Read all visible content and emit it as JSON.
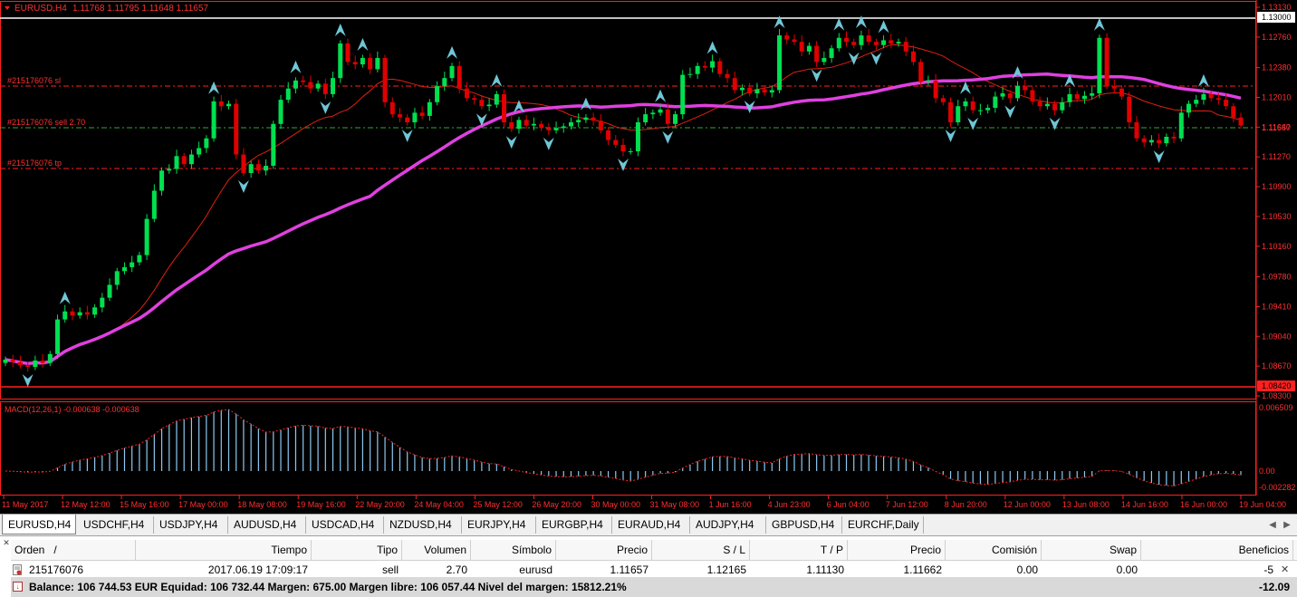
{
  "chart": {
    "symbol_title": "EURUSD,H4",
    "ohlc": "1.11768 1.11795 1.11648 1.11657",
    "price_scale": [
      "1.13130",
      "1.12760",
      "1.12380",
      "1.12010",
      "1.11640",
      "1.11270",
      "1.10900",
      "1.10530",
      "1.10160",
      "1.09780",
      "1.09410",
      "1.09040",
      "1.08670",
      "1.08300"
    ],
    "price_labels": {
      "upper_line": "1.13000",
      "lower_line": "1.08420",
      "current": "1.11657"
    },
    "order_lines": {
      "sl": "#215176076 sl",
      "sell": "#215176076 sell 2.70",
      "tp": "#215176076 tp"
    },
    "macd_label": "MACD(12,26,1) -0.000638 -0.000638",
    "macd_scale": [
      "0.006509",
      "0.00",
      "-0.002282"
    ],
    "time_axis": [
      "11 May 2017",
      "12 May 12:00",
      "15 May 16:00",
      "17 May 00:00",
      "18 May 08:00",
      "19 May 16:00",
      "22 May 20:00",
      "24 May 04:00",
      "25 May 12:00",
      "26 May 20:00",
      "30 May 00:00",
      "31 May 08:00",
      "1 Jun 16:00",
      "4 Jun 23:00",
      "6 Jun 04:00",
      "7 Jun 12:00",
      "8 Jun 20:00",
      "12 Jun 00:00",
      "13 Jun 08:00",
      "14 Jun 16:00",
      "16 Jun 00:00",
      "19 Jun 04:00"
    ],
    "colors": {
      "bull": "#00e050",
      "bear": "#e00000",
      "ma_slow": "#e040e0",
      "ma_fast": "#e02010",
      "arrow": "#6fc6d6",
      "macd": "#8fc8f0"
    }
  },
  "chart_data": {
    "type": "candlestick",
    "symbol": "EURUSD",
    "timeframe": "H4",
    "ylim": [
      1.083,
      1.1313
    ],
    "closes": [
      1.0875,
      1.0872,
      1.0868,
      1.0866,
      1.0874,
      1.0871,
      1.0882,
      1.0925,
      1.0935,
      1.093,
      1.0934,
      1.0931,
      1.094,
      1.0952,
      1.0968,
      1.0985,
      1.099,
      1.0996,
      1.1005,
      1.105,
      1.1085,
      1.111,
      1.1112,
      1.1128,
      1.1118,
      1.113,
      1.1138,
      1.115,
      1.1196,
      1.119,
      1.1193,
      1.113,
      1.1107,
      1.1118,
      1.111,
      1.1116,
      1.1168,
      1.1198,
      1.1212,
      1.1222,
      1.122,
      1.1212,
      1.1218,
      1.1205,
      1.1225,
      1.1268,
      1.1245,
      1.1242,
      1.125,
      1.1236,
      1.125,
      1.1195,
      1.118,
      1.1176,
      1.117,
      1.1182,
      1.1178,
      1.1195,
      1.1215,
      1.1225,
      1.124,
      1.1212,
      1.12,
      1.1198,
      1.119,
      1.1192,
      1.1205,
      1.117,
      1.1162,
      1.1173,
      1.1166,
      1.1168,
      1.1163,
      1.116,
      1.1163,
      1.1165,
      1.117,
      1.1173,
      1.1176,
      1.1172,
      1.116,
      1.1148,
      1.1142,
      1.1134,
      1.1134,
      1.117,
      1.118,
      1.1182,
      1.1186,
      1.1168,
      1.118,
      1.1229,
      1.123,
      1.124,
      1.1238,
      1.1246,
      1.123,
      1.1225,
      1.121,
      1.1213,
      1.1206,
      1.1211,
      1.1207,
      1.121,
      1.1278,
      1.1273,
      1.127,
      1.1258,
      1.1265,
      1.1245,
      1.125,
      1.1262,
      1.1275,
      1.127,
      1.1266,
      1.1278,
      1.127,
      1.1266,
      1.1272,
      1.1268,
      1.127,
      1.1258,
      1.1245,
      1.122,
      1.1222,
      1.12,
      1.1195,
      1.117,
      1.119,
      1.1196,
      1.1185,
      1.1185,
      1.1188,
      1.1202,
      1.1206,
      1.12,
      1.1215,
      1.121,
      1.1196,
      1.119,
      1.1193,
      1.1185,
      1.1195,
      1.1205,
      1.1199,
      1.1203,
      1.1206,
      1.1275,
      1.1215,
      1.1212,
      1.1202,
      1.117,
      1.115,
      1.1145,
      1.1148,
      1.1144,
      1.1152,
      1.115,
      1.1182,
      1.1193,
      1.1198,
      1.1205,
      1.12,
      1.1198,
      1.119,
      1.1176,
      1.1166
    ]
  },
  "tabs": [
    "EURUSD,H4",
    "USDCHF,H4",
    "USDJPY,H4",
    "AUDUSD,H4",
    "USDCAD,H4",
    "NZDUSD,H4",
    "EURJPY,H4",
    "EURGBP,H4",
    "EURAUD,H4",
    "AUDJPY,H4",
    "GBPUSD,H4",
    "EURCHF,Daily"
  ],
  "terminal": {
    "columns": {
      "orden": "Orden",
      "sort": "/",
      "tiempo": "Tiempo",
      "tipo": "Tipo",
      "volumen": "Volumen",
      "simbolo": "Símbolo",
      "precio": "Precio",
      "sl": "S / L",
      "tp": "T / P",
      "precio2": "Precio",
      "comision": "Comisión",
      "swap": "Swap",
      "beneficios": "Beneficios"
    },
    "order": {
      "id": "215176076",
      "time": "2017.06.19 17:09:17",
      "type": "sell",
      "volume": "2.70",
      "symbol": "eurusd",
      "price": "1.11657",
      "sl": "1.12165",
      "tp": "1.11130",
      "current": "1.11662",
      "commission": "0.00",
      "swap": "0.00",
      "profit": "-5"
    },
    "balance_line": "Balance: 106 744.53 EUR  Equidad: 106 732.44  Margen: 675.00  Margen libre: 106 057.44  Nivel del margen: 15812.21%",
    "total_profit": "-12.09"
  }
}
